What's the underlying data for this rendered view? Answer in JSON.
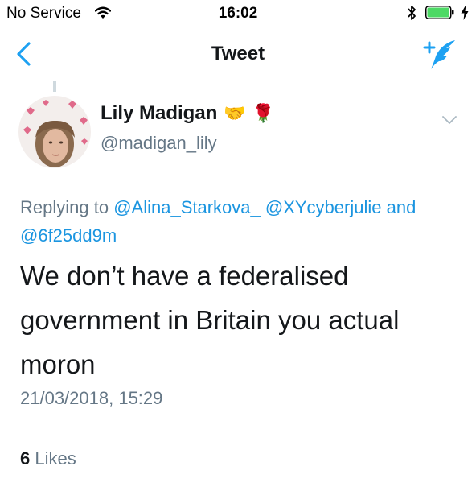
{
  "status_bar": {
    "carrier": "No Service",
    "time": "16:02",
    "icons": [
      "wifi-icon",
      "bluetooth-icon",
      "battery-icon",
      "charging-icon"
    ],
    "battery_color": "#4cd964"
  },
  "nav": {
    "title": "Tweet",
    "back_icon": "chevron-left-icon",
    "compose_icon": "compose-tweet-icon",
    "accent": "#1da1f2"
  },
  "tweet": {
    "author": {
      "display_name": "Lily Madigan",
      "name_emojis": [
        "🤝",
        "🌹"
      ],
      "handle": "@madigan_lily"
    },
    "reply_context": {
      "prefix": "Replying to",
      "mentions": [
        "@Alina_Starkova_",
        "@XYcyberjulie",
        "@6f25dd9m"
      ],
      "conjunction": "and"
    },
    "text": "We don’t have a federalised government in Britain you actual moron",
    "timestamp": "21/03/2018, 15:29",
    "likes": {
      "count": "6",
      "label": "Likes"
    }
  }
}
